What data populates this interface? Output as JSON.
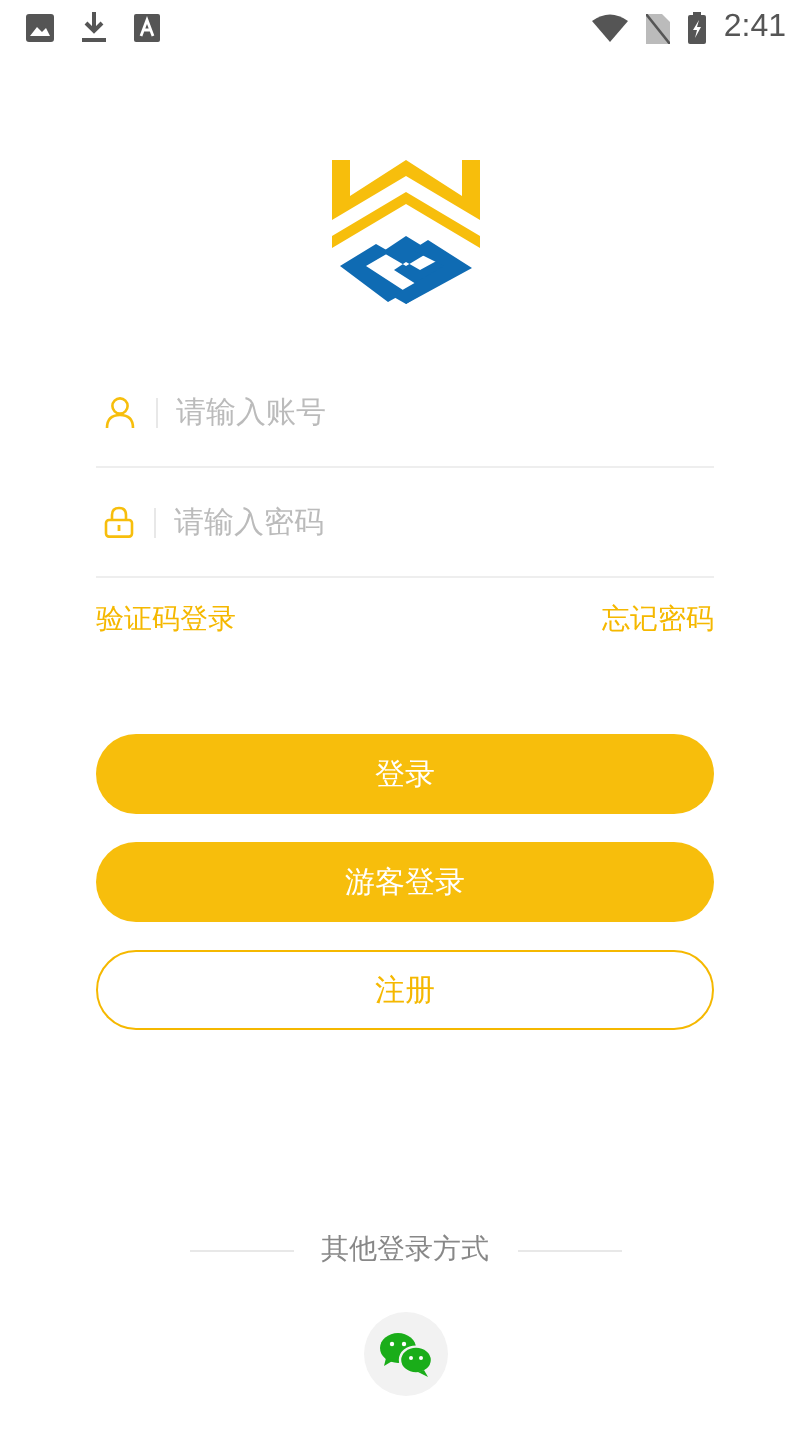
{
  "status_bar": {
    "time": "2:41"
  },
  "fields": [
    {
      "kind": "account",
      "placeholder": "请输入账号"
    },
    {
      "kind": "password",
      "placeholder": "请输入密码"
    }
  ],
  "links": {
    "code_login": "验证码登录",
    "forgot": "忘记密码"
  },
  "buttons": [
    {
      "kind": "filled",
      "label": "登录"
    },
    {
      "kind": "filled",
      "label": "游客登录"
    },
    {
      "kind": "outline",
      "label": "注册"
    }
  ],
  "other_login": {
    "title": "其他登录方式"
  }
}
